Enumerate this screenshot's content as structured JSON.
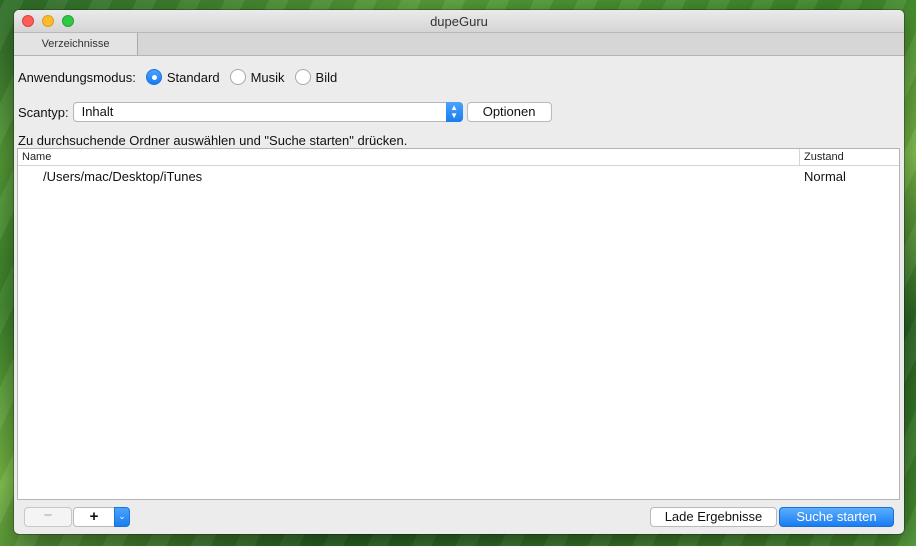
{
  "window": {
    "title": "dupeGuru"
  },
  "tabs": [
    {
      "label": "Verzeichnisse"
    }
  ],
  "mode": {
    "label": "Anwendungsmodus:",
    "options": [
      {
        "label": "Standard",
        "checked": true
      },
      {
        "label": "Musik",
        "checked": false
      },
      {
        "label": "Bild",
        "checked": false
      }
    ]
  },
  "scan": {
    "label": "Scantyp:",
    "selected": "Inhalt",
    "options_button": "Optionen"
  },
  "hint": "Zu durchsuchende Ordner auswählen und \"Suche starten\" drücken.",
  "table": {
    "columns": [
      "Name",
      "Zustand"
    ],
    "rows": [
      {
        "name": "/Users/mac/Desktop/iTunes",
        "state": "Normal"
      }
    ]
  },
  "bottom": {
    "remove_label": "−",
    "add_label": "+",
    "add_menu_icon": "chevron-down",
    "load_results": "Lade Ergebnisse",
    "start_search": "Suche starten"
  },
  "colors": {
    "accent": "#1a7cf0"
  }
}
